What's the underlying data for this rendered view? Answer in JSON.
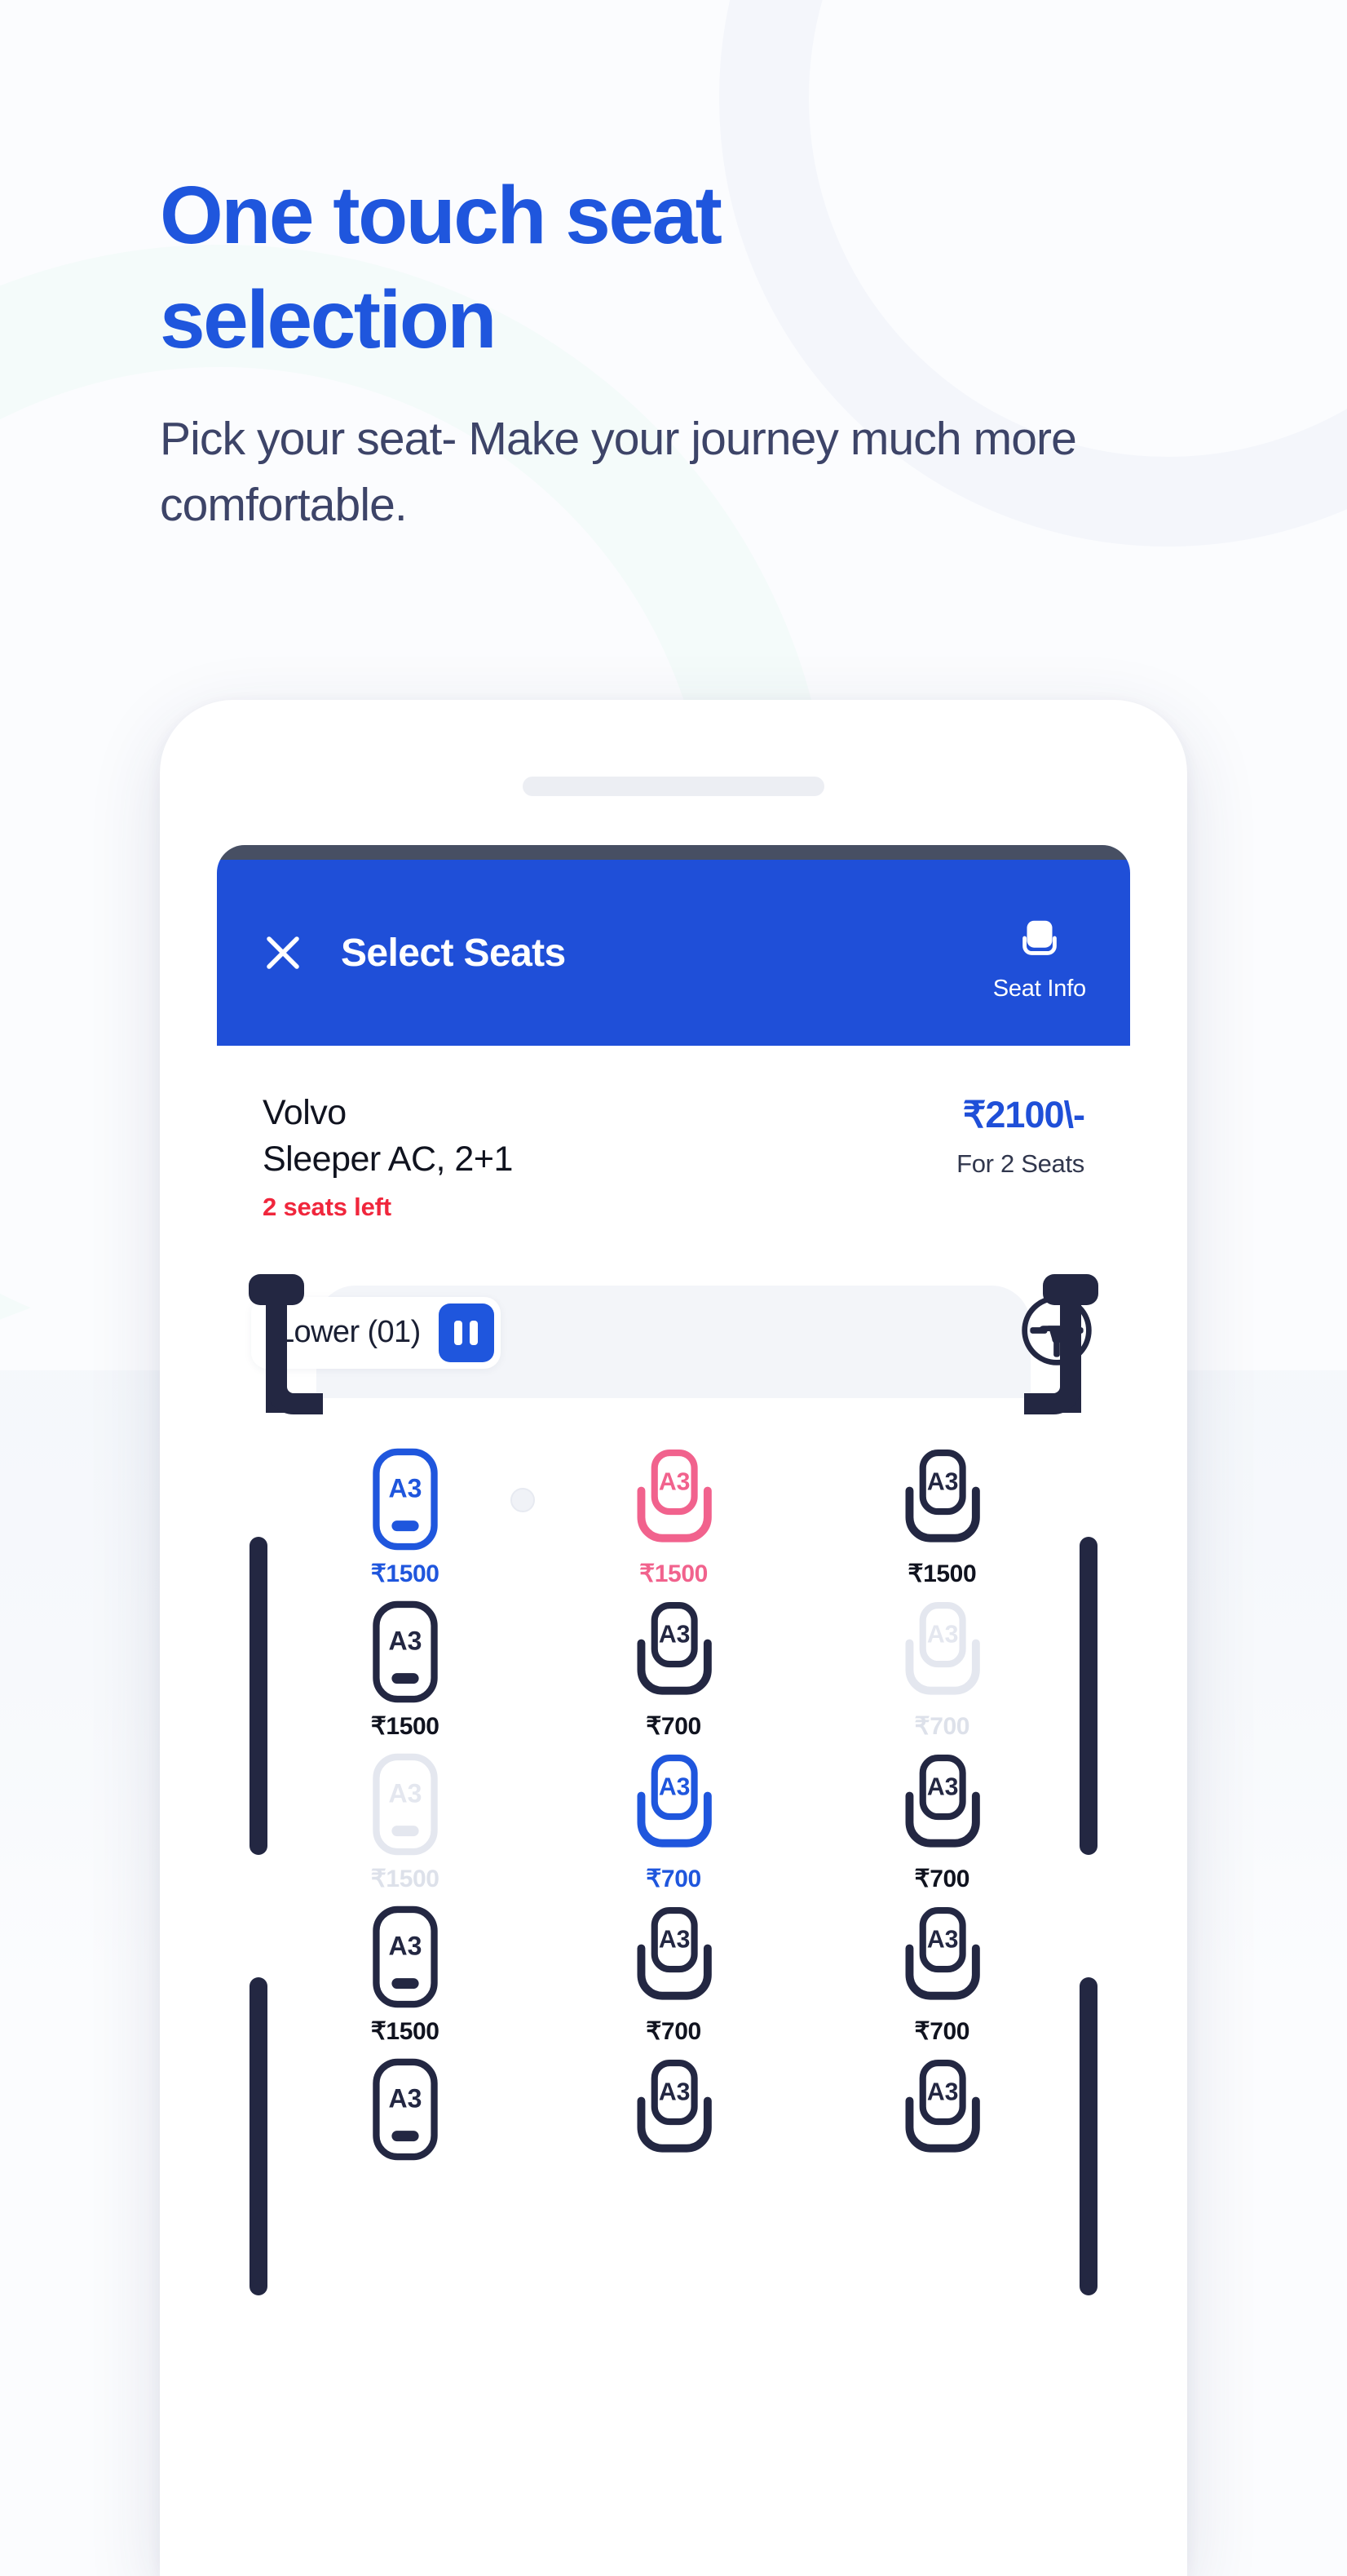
{
  "hero": {
    "heading": "One touch seat selection",
    "subheading": "Pick your seat- Make your journey much more comfortable.",
    "heading_color": "#1f56dd",
    "subheading_color": "#3d4468"
  },
  "app": {
    "header": {
      "close_icon": "close-icon",
      "title": "Select Seats",
      "seat_info_icon": "seat-icon",
      "seat_info_label": "Seat Info",
      "background_color": "#1f4fd8"
    },
    "bus_info": {
      "operator": "Volvo",
      "bus_type": "Sleeper AC, 2+1",
      "availability": "2 seats left",
      "availability_color": "#f0263c",
      "fare": "₹2100\\-",
      "fare_color": "#1f4fd8",
      "fare_note": "For 2 Seats"
    },
    "deck": {
      "label": "Lower (01)",
      "toggle_icon": "deck-toggle-icon",
      "toggle_color": "#1f56dd",
      "driver_icon": "steering-wheel-icon"
    },
    "legend_colors": {
      "available": "#232742",
      "selected": "#1f56dd",
      "ladies": "#f1628d",
      "booked": "#e4e7ef"
    },
    "seat_grid": {
      "rows": [
        [
          {
            "label": "A3",
            "price": "₹1500",
            "type": "sleeper",
            "state": "selected"
          },
          {
            "label": "A3",
            "price": "₹1500",
            "type": "seater",
            "state": "ladies"
          },
          {
            "label": "A3",
            "price": "₹1500",
            "type": "seater",
            "state": "available"
          }
        ],
        [
          {
            "label": "A3",
            "price": "₹1500",
            "type": "sleeper",
            "state": "available"
          },
          {
            "label": "A3",
            "price": "₹700",
            "type": "seater",
            "state": "available"
          },
          {
            "label": "A3",
            "price": "₹700",
            "type": "seater",
            "state": "booked"
          }
        ],
        [
          {
            "label": "A3",
            "price": "₹1500",
            "type": "sleeper",
            "state": "booked"
          },
          {
            "label": "A3",
            "price": "₹700",
            "type": "seater",
            "state": "selected"
          },
          {
            "label": "A3",
            "price": "₹700",
            "type": "seater",
            "state": "available"
          }
        ],
        [
          {
            "label": "A3",
            "price": "₹1500",
            "type": "sleeper",
            "state": "available"
          },
          {
            "label": "A3",
            "price": "₹700",
            "type": "seater",
            "state": "available"
          },
          {
            "label": "A3",
            "price": "₹700",
            "type": "seater",
            "state": "available"
          }
        ],
        [
          {
            "label": "A3",
            "price": "",
            "type": "sleeper",
            "state": "available"
          },
          {
            "label": "A3",
            "price": "",
            "type": "seater",
            "state": "available"
          },
          {
            "label": "A3",
            "price": "",
            "type": "seater",
            "state": "available"
          }
        ]
      ]
    }
  }
}
